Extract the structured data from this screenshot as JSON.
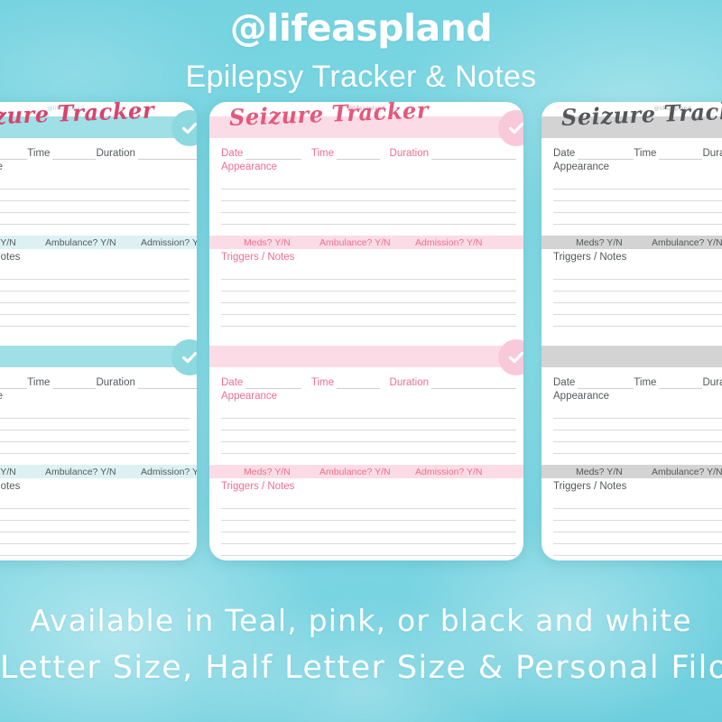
{
  "header": {
    "handle": "@lifeaspland",
    "subtitle": "Epilepsy Tracker & Notes"
  },
  "footer": {
    "line1": "Available in Teal, pink, or black and white",
    "line2": "Letter Size, Half Letter Size & Personal Filo-"
  },
  "colors": {
    "background_teal": "#74d2e0",
    "pink_band": "#fbdce6",
    "pink_text": "#ef6d90",
    "pink_title": "#e4587c",
    "teal_band": "#9ee0e6",
    "teal_row_band": "#ddf1f2",
    "teal_text": "#555b5e",
    "bw_band": "#d3d3d3",
    "bw_text": "#54585a",
    "rule_line": "#d9d9d9",
    "white": "#ffffff"
  },
  "sheet": {
    "watermark": "@lifeaspland",
    "title": "Seizure Tracker",
    "fields": {
      "date": "Date",
      "time": "Time",
      "duration": "Duration"
    },
    "appearance_label": "Appearance",
    "meds_row": {
      "meds": "Meds?  Y/N",
      "ambulance": "Ambulance?  Y/N",
      "admission": "Admission?  Y/N"
    },
    "triggers_label": "Triggers / Notes",
    "check_icon": "check-icon",
    "appearance_lines": 5,
    "triggers_lines": 5
  },
  "pages": [
    {
      "id": "page-teal",
      "theme": "teal",
      "name": "teal-planner-page"
    },
    {
      "id": "page-pink",
      "theme": "pink",
      "name": "pink-planner-page"
    },
    {
      "id": "page-bw",
      "theme": "bw",
      "name": "black-white-planner-page"
    }
  ]
}
